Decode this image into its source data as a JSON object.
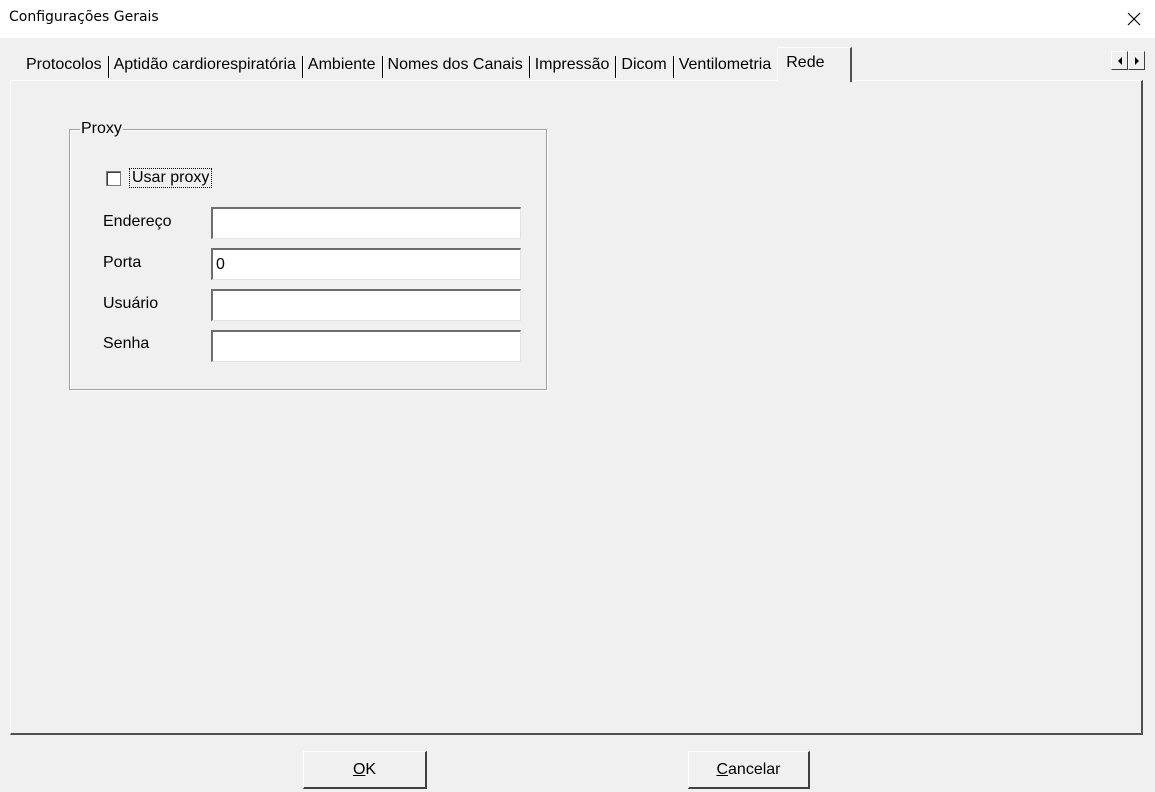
{
  "window": {
    "title": "Configurações Gerais"
  },
  "tabs": [
    {
      "label": "Protocolos",
      "active": false
    },
    {
      "label": "Aptidão cardiorespiratória",
      "active": false
    },
    {
      "label": "Ambiente",
      "active": false
    },
    {
      "label": "Nomes dos Canais",
      "active": false
    },
    {
      "label": "Impressão",
      "active": false
    },
    {
      "label": "Dicom",
      "active": false
    },
    {
      "label": "Ventilometria",
      "active": false
    },
    {
      "label": "Rede",
      "active": true
    }
  ],
  "proxy": {
    "group_title": "Proxy",
    "use_proxy_label": "Usar proxy",
    "use_proxy_checked": false,
    "address_label": "Endereço",
    "address_value": "",
    "port_label": "Porta",
    "port_value": "0",
    "user_label": "Usuário",
    "user_value": "",
    "password_label": "Senha",
    "password_value": ""
  },
  "buttons": {
    "ok_mnemonic": "O",
    "ok_rest": "K",
    "cancel_mnemonic": "C",
    "cancel_rest": "ancelar"
  },
  "icons": {
    "close": "close-icon",
    "scroll_left": "arrow-left-icon",
    "scroll_right": "arrow-right-icon"
  }
}
